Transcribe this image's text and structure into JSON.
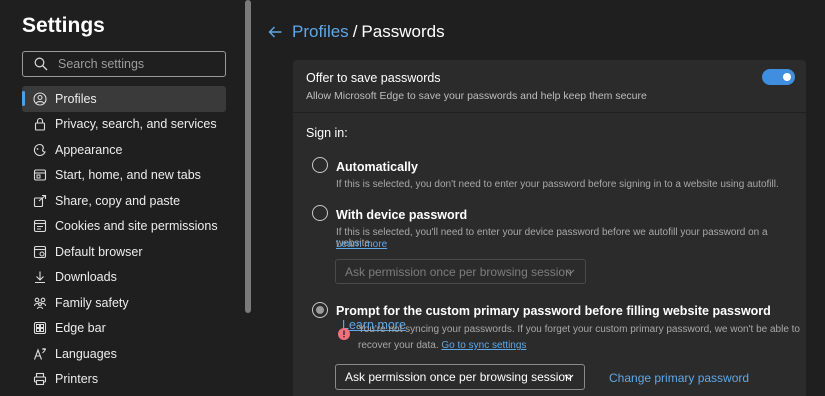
{
  "sidebar": {
    "title": "Settings",
    "search_placeholder": "Search settings",
    "items": [
      {
        "label": "Profiles",
        "icon": "profile-icon",
        "active": true
      },
      {
        "label": "Privacy, search, and services",
        "icon": "lock-icon"
      },
      {
        "label": "Appearance",
        "icon": "appearance-icon"
      },
      {
        "label": "Start, home, and new tabs",
        "icon": "home-icon"
      },
      {
        "label": "Share, copy and paste",
        "icon": "share-icon"
      },
      {
        "label": "Cookies and site permissions",
        "icon": "cookies-icon"
      },
      {
        "label": "Default browser",
        "icon": "browser-icon"
      },
      {
        "label": "Downloads",
        "icon": "download-icon"
      },
      {
        "label": "Family safety",
        "icon": "family-icon"
      },
      {
        "label": "Edge bar",
        "icon": "edge-bar-icon"
      },
      {
        "label": "Languages",
        "icon": "languages-icon"
      },
      {
        "label": "Printers",
        "icon": "printer-icon"
      }
    ]
  },
  "header": {
    "breadcrumb_link": "Profiles",
    "separator": "/",
    "breadcrumb_current": "Passwords"
  },
  "offer": {
    "title": "Offer to save passwords",
    "description": "Allow Microsoft Edge to save your passwords and help keep them secure",
    "toggle_on": true
  },
  "signin": {
    "label": "Sign in:",
    "automatic": {
      "title": "Automatically",
      "description": "If this is selected, you don't need to enter your password before signing in to a website using autofill."
    },
    "device": {
      "title": "With device password",
      "description": "If this is selected, you'll need to enter your device password before we autofill your password on a website.",
      "learn_more": "Learn more",
      "select_value": "Ask permission once per browsing session"
    },
    "custom": {
      "title": "Prompt for the custom primary password before filling website password",
      "learn_more": "Learn more",
      "warning_line1": "You're not syncing your passwords. If you forget your custom primary password, we won't be able to",
      "warning_line2": "recover your data.",
      "sync_link": "Go to sync settings",
      "select_value": "Ask permission once per browsing session",
      "change_link": "Change primary password"
    }
  },
  "colors": {
    "accent": "#5ea8e8",
    "toggle": "#3f8ee0",
    "warning": "#f1707b"
  }
}
